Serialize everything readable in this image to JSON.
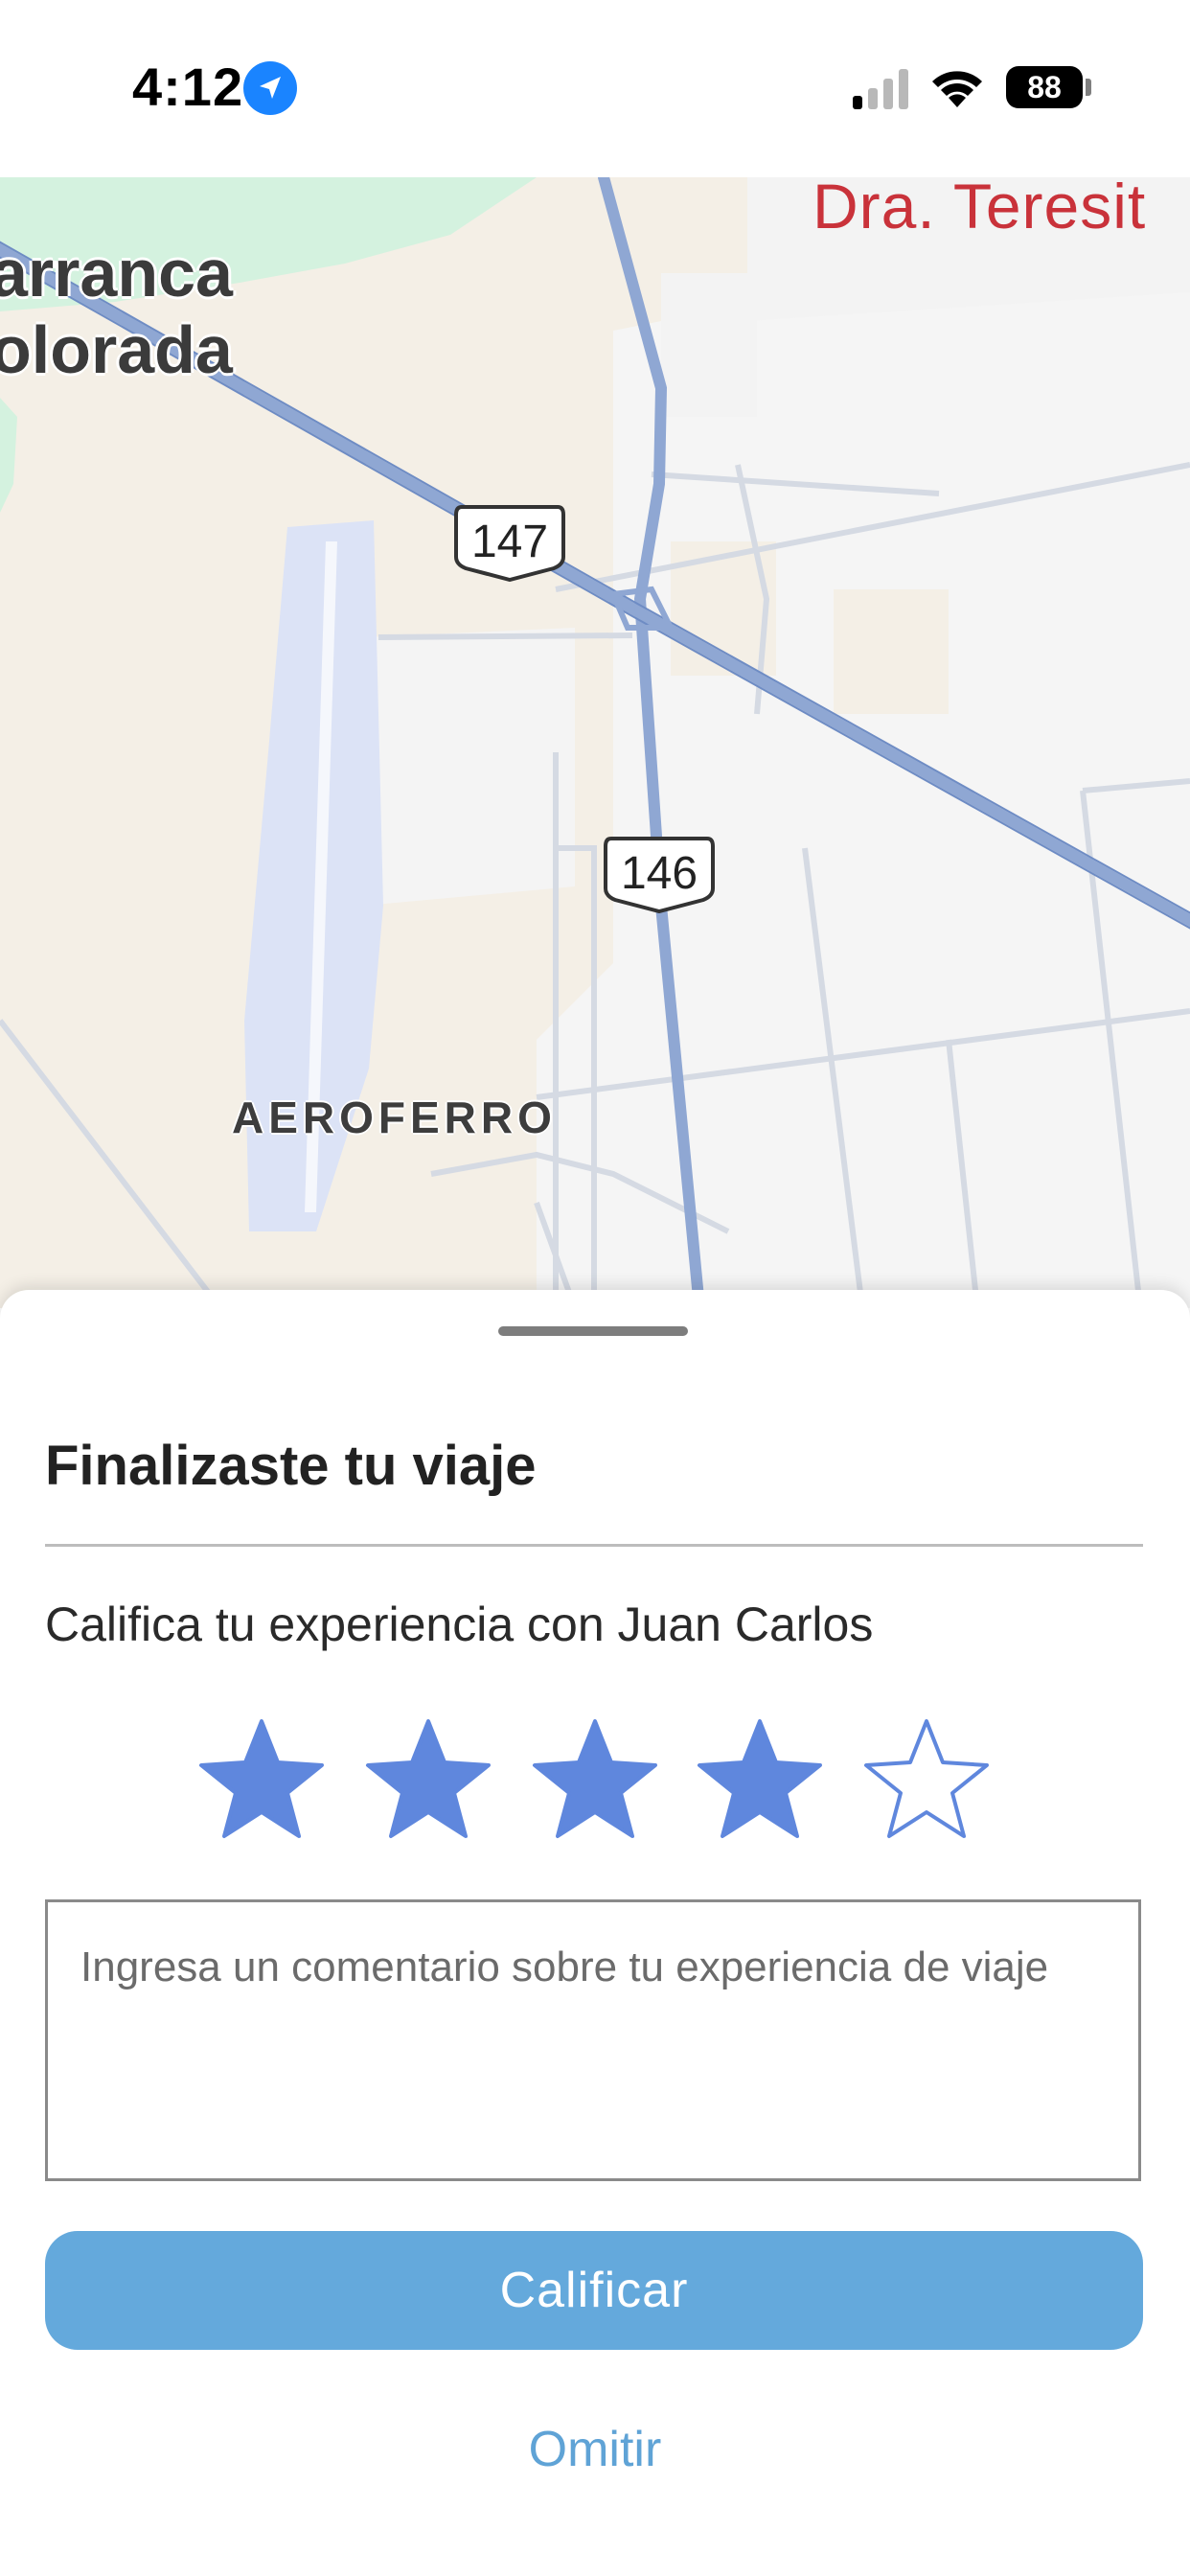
{
  "status_bar": {
    "time": "4:12",
    "battery": "88",
    "icons": [
      "location-arrow-icon",
      "cellular-signal-icon",
      "wifi-icon",
      "battery-icon"
    ]
  },
  "map": {
    "places": [
      "arranca\nolorada",
      "Dra. Teresit",
      "AEROFERRO"
    ],
    "route_shields": [
      "147",
      "146"
    ]
  },
  "sheet": {
    "title": "Finalizaste tu viaje",
    "prompt": "Califica tu experiencia con Juan Carlos",
    "rating": {
      "value": 4,
      "max": 5
    },
    "comment_placeholder": "Ingresa un comentario sobre tu experiencia de viaje",
    "submit_label": "Calificar",
    "skip_label": "Omitir"
  },
  "colors": {
    "star": "#5f87dd",
    "button": "#64a9dc",
    "link": "#5fa3d6",
    "map_land": "#f4efe6",
    "map_road": "#8fa7d3",
    "map_airport": "#dce3f6",
    "map_park": "#d4f2df"
  }
}
